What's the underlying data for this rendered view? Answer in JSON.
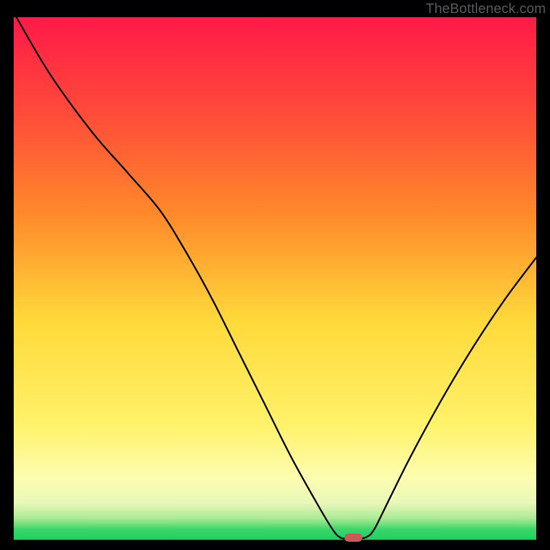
{
  "watermark": "TheBottleneck.com",
  "colors": {
    "top": "#ff1a48",
    "mid_upper": "#ff8a2a",
    "mid": "#ffd93a",
    "mid_lower": "#fff26a",
    "pale_yellow": "#fdfdb0",
    "pale_green": "#d6f5b3",
    "green": "#3bd66a",
    "bright_green": "#1bd15d",
    "marker": "#c95a58",
    "line": "#000000"
  },
  "chart_data": {
    "type": "line",
    "title": "",
    "xlabel": "",
    "ylabel": "",
    "xlim": [
      0,
      100
    ],
    "ylim": [
      0,
      100
    ],
    "curve": [
      {
        "x": 0.5,
        "y": 100
      },
      {
        "x": 7,
        "y": 89
      },
      {
        "x": 15,
        "y": 78
      },
      {
        "x": 22,
        "y": 70
      },
      {
        "x": 28,
        "y": 63
      },
      {
        "x": 33,
        "y": 55
      },
      {
        "x": 38,
        "y": 46
      },
      {
        "x": 43,
        "y": 36
      },
      {
        "x": 48,
        "y": 26
      },
      {
        "x": 53,
        "y": 16
      },
      {
        "x": 58,
        "y": 7
      },
      {
        "x": 61,
        "y": 2
      },
      {
        "x": 62.5,
        "y": 0.4
      },
      {
        "x": 64,
        "y": 0.2
      },
      {
        "x": 66,
        "y": 0.2
      },
      {
        "x": 67.5,
        "y": 0.5
      },
      {
        "x": 69,
        "y": 2
      },
      {
        "x": 72,
        "y": 8
      },
      {
        "x": 76,
        "y": 16
      },
      {
        "x": 82,
        "y": 27
      },
      {
        "x": 88,
        "y": 37
      },
      {
        "x": 94,
        "y": 46
      },
      {
        "x": 100,
        "y": 54
      }
    ],
    "marker": {
      "x": 65,
      "y": 0.4,
      "w": 3.5,
      "h": 1.6
    }
  },
  "gradient_stops": [
    {
      "pct": 0,
      "c": "#ff1a48"
    },
    {
      "pct": 18,
      "c": "#ff4a3a"
    },
    {
      "pct": 38,
      "c": "#ff8a2a"
    },
    {
      "pct": 58,
      "c": "#ffd93a"
    },
    {
      "pct": 78,
      "c": "#fff26a"
    },
    {
      "pct": 88,
      "c": "#fdfdb0"
    },
    {
      "pct": 93,
      "c": "#e8f8b8"
    },
    {
      "pct": 96,
      "c": "#a8e994"
    },
    {
      "pct": 98,
      "c": "#3bd66a"
    },
    {
      "pct": 100,
      "c": "#1bd15d"
    }
  ]
}
